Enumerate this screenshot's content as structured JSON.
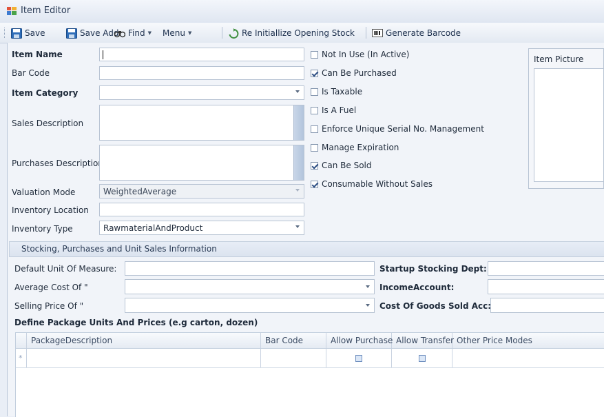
{
  "window": {
    "title": "Item Editor"
  },
  "toolbar": {
    "save": "Save",
    "save_add": "Save Add",
    "find": "Find",
    "menu": "Menu",
    "reinit": "Re Initiallize Opening Stock",
    "barcode": "Generate Barcode"
  },
  "form": {
    "item_name": {
      "label": "Item Name",
      "value": ""
    },
    "bar_code": {
      "label": "Bar Code",
      "value": ""
    },
    "item_category": {
      "label": "Item Category",
      "value": ""
    },
    "sales_description": {
      "label": "Sales Description",
      "value": ""
    },
    "purchases_description": {
      "label": "Purchases Description",
      "value": ""
    },
    "valuation_mode": {
      "label": "Valuation Mode",
      "value": "WeightedAverage"
    },
    "inventory_location": {
      "label": "Inventory Location",
      "value": ""
    },
    "inventory_type": {
      "label": "Inventory Type",
      "value": "RawmaterialAndProduct"
    }
  },
  "checkboxes": [
    {
      "label": "Not In Use (In Active)",
      "checked": false
    },
    {
      "label": "Can Be Purchased",
      "checked": true
    },
    {
      "label": "Is Taxable",
      "checked": false
    },
    {
      "label": "Is A Fuel",
      "checked": false
    },
    {
      "label": "Enforce Unique Serial No. Management",
      "checked": false
    },
    {
      "label": "Manage Expiration",
      "checked": false
    },
    {
      "label": "Can Be Sold",
      "checked": true
    },
    {
      "label": "Consumable Without Sales",
      "checked": true
    }
  ],
  "item_picture": {
    "label": "Item Picture"
  },
  "stocking": {
    "section_title": "Stocking, Purchases and Unit Sales Information",
    "default_uom": "Default Unit Of Measure:",
    "avg_cost": "Average Cost Of \"",
    "selling_price": "Selling Price Of \"",
    "startup_dept": "Startup Stocking Dept:",
    "income_account": "IncomeAccount:",
    "cogs_account": "Cost Of Goods Sold Acc:"
  },
  "packages": {
    "title": "Define Package Units And Prices (e.g carton, dozen)",
    "columns": [
      "PackageDescription",
      "Bar Code",
      "Allow Purchase",
      "Allow Transfer",
      "Other Price Modes"
    ],
    "new_row_marker": "*"
  },
  "colors": {
    "accent": "#2e4f84",
    "window_bg": "#e9eef6"
  }
}
